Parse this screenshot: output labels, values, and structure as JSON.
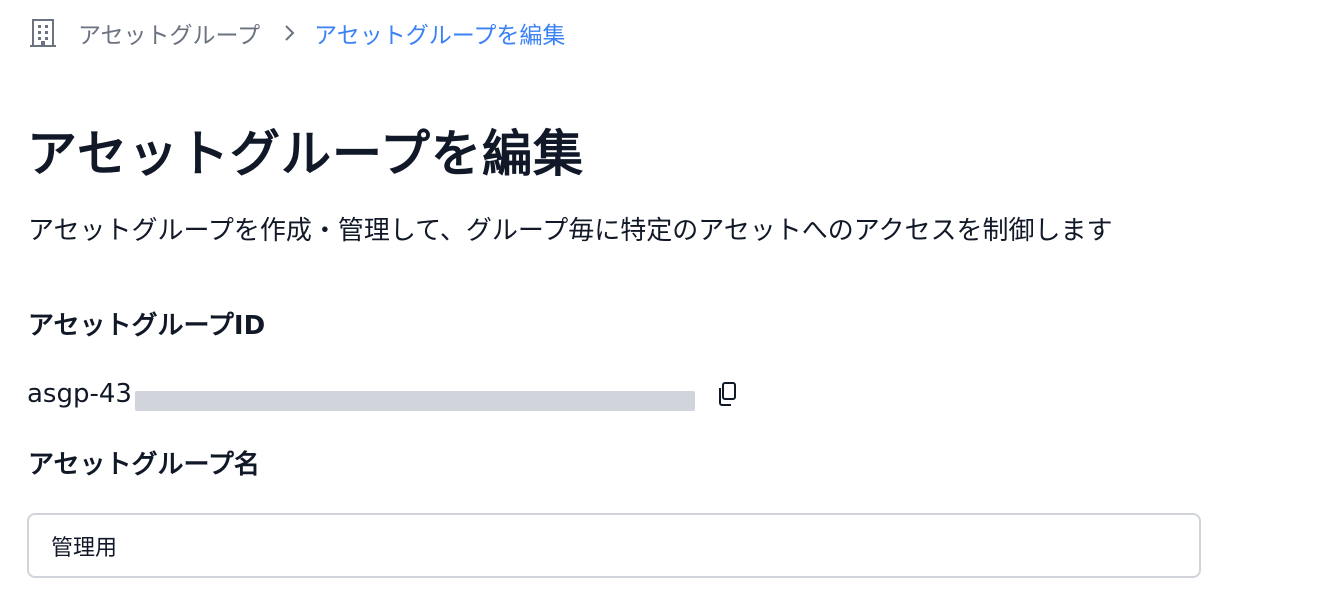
{
  "breadcrumb": {
    "icon": "building-icon",
    "parent": "アセットグループ",
    "separator_icon": "chevron-right-icon",
    "current": "アセットグループを編集"
  },
  "page": {
    "title": "アセットグループを編集",
    "description": "アセットグループを作成・管理して、グループ毎に特定のアセットへのアクセスを制御します"
  },
  "asset_group_id": {
    "label": "アセットグループID",
    "value": "asgp-43",
    "copy_icon": "copy-icon"
  },
  "asset_group_name": {
    "label": "アセットグループ名",
    "value": "管理用"
  },
  "colors": {
    "accent": "#3b82f6",
    "muted": "#6b7280",
    "text": "#111827",
    "border": "#d1d5db"
  }
}
